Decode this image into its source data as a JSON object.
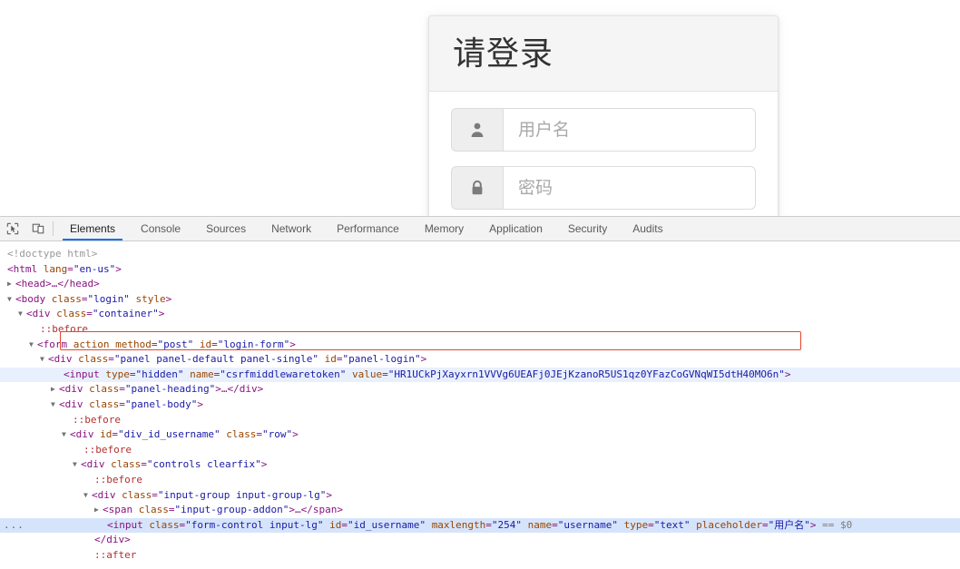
{
  "page": {
    "login_panel": {
      "title": "请登录",
      "fields": [
        {
          "name": "username",
          "icon": "user-icon",
          "placeholder": "用户名",
          "value": ""
        },
        {
          "name": "password",
          "icon": "lock-icon",
          "placeholder": "密码",
          "value": ""
        }
      ]
    }
  },
  "devtools": {
    "toolbar": {
      "inspect_icon": "inspect-element-icon",
      "device_icon": "device-toolbar-icon",
      "tabs": [
        {
          "label": "Elements",
          "active": true
        },
        {
          "label": "Console",
          "active": false
        },
        {
          "label": "Sources",
          "active": false
        },
        {
          "label": "Network",
          "active": false
        },
        {
          "label": "Performance",
          "active": false
        },
        {
          "label": "Memory",
          "active": false
        },
        {
          "label": "Application",
          "active": false
        },
        {
          "label": "Security",
          "active": false
        },
        {
          "label": "Audits",
          "active": false
        }
      ],
      "accent_color": "#1a73e8"
    },
    "dom": {
      "doctype": "<!doctype html>",
      "html_tag": "html",
      "html_attr_name": "lang",
      "html_attr_value": "en-us",
      "head_collapsed": "<head>…</head>",
      "body_tag": "body",
      "body_class_name": "class",
      "body_class_value": "login",
      "body_style_attr": "style",
      "container_tag": "div",
      "container_attr": "class",
      "container_value": "container",
      "before_pseudo": "::before",
      "after_pseudo": "::after",
      "form_tag": "form",
      "form_action": "action",
      "form_method_name": "method",
      "form_method_value": "post",
      "form_id_name": "id",
      "form_id_value": "login-form",
      "panel_div_tag": "div",
      "panel_div_class_name": "class",
      "panel_div_class_value": "panel panel-default panel-single",
      "panel_div_id_name": "id",
      "panel_div_id_value": "panel-login",
      "csrf_input_tag": "input",
      "csrf_type_name": "type",
      "csrf_type_value": "hidden",
      "csrf_name_name": "name",
      "csrf_name_value": "csrfmiddlewaretoken",
      "csrf_value_name": "value",
      "csrf_value_value": "HR1UCkPjXayxrn1VVVg6UEAFj0JEjKzanoR5US1qz0YFazCoGVNqWI5dtH40MO6n",
      "panel_heading_collapsed_tag": "div",
      "panel_heading_attr": "class",
      "panel_heading_value": "panel-heading",
      "panel_heading_collapsed_text": "…</div>",
      "panel_body_tag": "div",
      "panel_body_attr": "class",
      "panel_body_value": "panel-body",
      "row_div_tag": "div",
      "row_div_id_name": "id",
      "row_div_id_value": "div_id_username",
      "row_div_class_name": "class",
      "row_div_class_value": "row",
      "controls_tag": "div",
      "controls_attr": "class",
      "controls_value": "controls clearfix",
      "input_group_tag": "div",
      "input_group_attr": "class",
      "input_group_value": "input-group input-group-lg",
      "addon_span_tag": "span",
      "addon_span_attr": "class",
      "addon_span_value": "input-group-addon",
      "addon_span_collapsed_text": "…</span>",
      "username_input_tag": "input",
      "username_class_name": "class",
      "username_class_value": "form-control input-lg",
      "username_id_name": "id",
      "username_id_value": "id_username",
      "username_maxlength_name": "maxlength",
      "username_maxlength_value": "254",
      "username_name_name": "name",
      "username_name_value": "username",
      "username_type_name": "type",
      "username_type_value": "text",
      "username_placeholder_name": "placeholder",
      "username_placeholder_value": "用户名",
      "selected_marker": "== $0",
      "close_div": "</div>",
      "ellipsis_marker": "...",
      "highlight_box_color": "#e8452c",
      "selected_row_color": "#d6e4fb"
    }
  }
}
